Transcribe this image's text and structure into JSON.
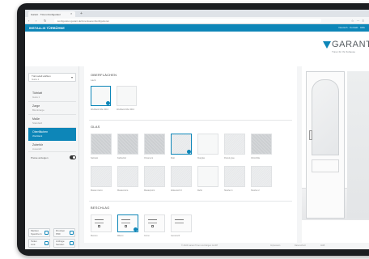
{
  "browser": {
    "tab_title": "Garant · Türen-Konfigurator",
    "tab_close": "×",
    "new_tab": "+",
    "nav": [
      "‹",
      "›",
      "↻"
    ],
    "url": "konfigurator.garant.de/innentueren/konfigurieren",
    "icons": "☆ ⋯ ≡"
  },
  "topbar": {
    "left": "INSTALLIX TÜRBÜHNE",
    "right": "Deutsch · Kontakt · Hilfe"
  },
  "brand": {
    "name": "GARANT",
    "tagline": "Türen für Ihr Zuhause",
    "accent": "#0d86b8"
  },
  "sidebar": {
    "select": {
      "label": "Türmodell wählen",
      "value": "Gara 1",
      "arrow": "▾"
    },
    "categories": [
      {
        "title": "Türblatt",
        "sub": "Gara 1"
      },
      {
        "title": "Zarge",
        "sub": "Blockzarge"
      },
      {
        "title": "Maße",
        "sub": "Standard"
      },
      {
        "title": "Oberflächen",
        "sub": "Weißlack"
      },
      {
        "title": "Zubehör",
        "sub": "Auswahl"
      },
      {
        "title": "Extras",
        "sub": "Optional"
      }
    ],
    "toggle_label": "Preise anzeigen",
    "buttons": [
      {
        "line1": "Merken",
        "line2": "Speichern"
      },
      {
        "line1": "Drucken",
        "line2": "PDF"
      },
      {
        "line1": "Teilen",
        "line2": "Link"
      },
      {
        "line1": "Anfrage",
        "line2": "Senden"
      }
    ]
  },
  "main": {
    "surfaces": {
      "title": "OBERFLÄCHEN",
      "sub": "Lack",
      "items": [
        "Weißlack RAL 9016",
        "Weißlack RAL 9010"
      ]
    },
    "glass": {
      "title": "GLAS",
      "items": [
        "Satinato",
        "Kathedral",
        "Ornament",
        "Matt",
        "Klarglas",
        "Parsol grau",
        "Chinchilla",
        "Master-Carré",
        "Mastercarré",
        "Masterpoint",
        "Altdeutsch K",
        "Reflo",
        "Streifen 1",
        "Streifen 2"
      ]
    },
    "hardware": {
      "title": "BESCHLAG",
      "items": [
        "Merano",
        "Milano",
        "Como",
        "Genova R"
      ]
    }
  },
  "footer": {
    "left": "© 2024 Garant Türen und Zargen GmbH",
    "links": [
      "Impressum",
      "Datenschutz",
      "AGB"
    ]
  }
}
